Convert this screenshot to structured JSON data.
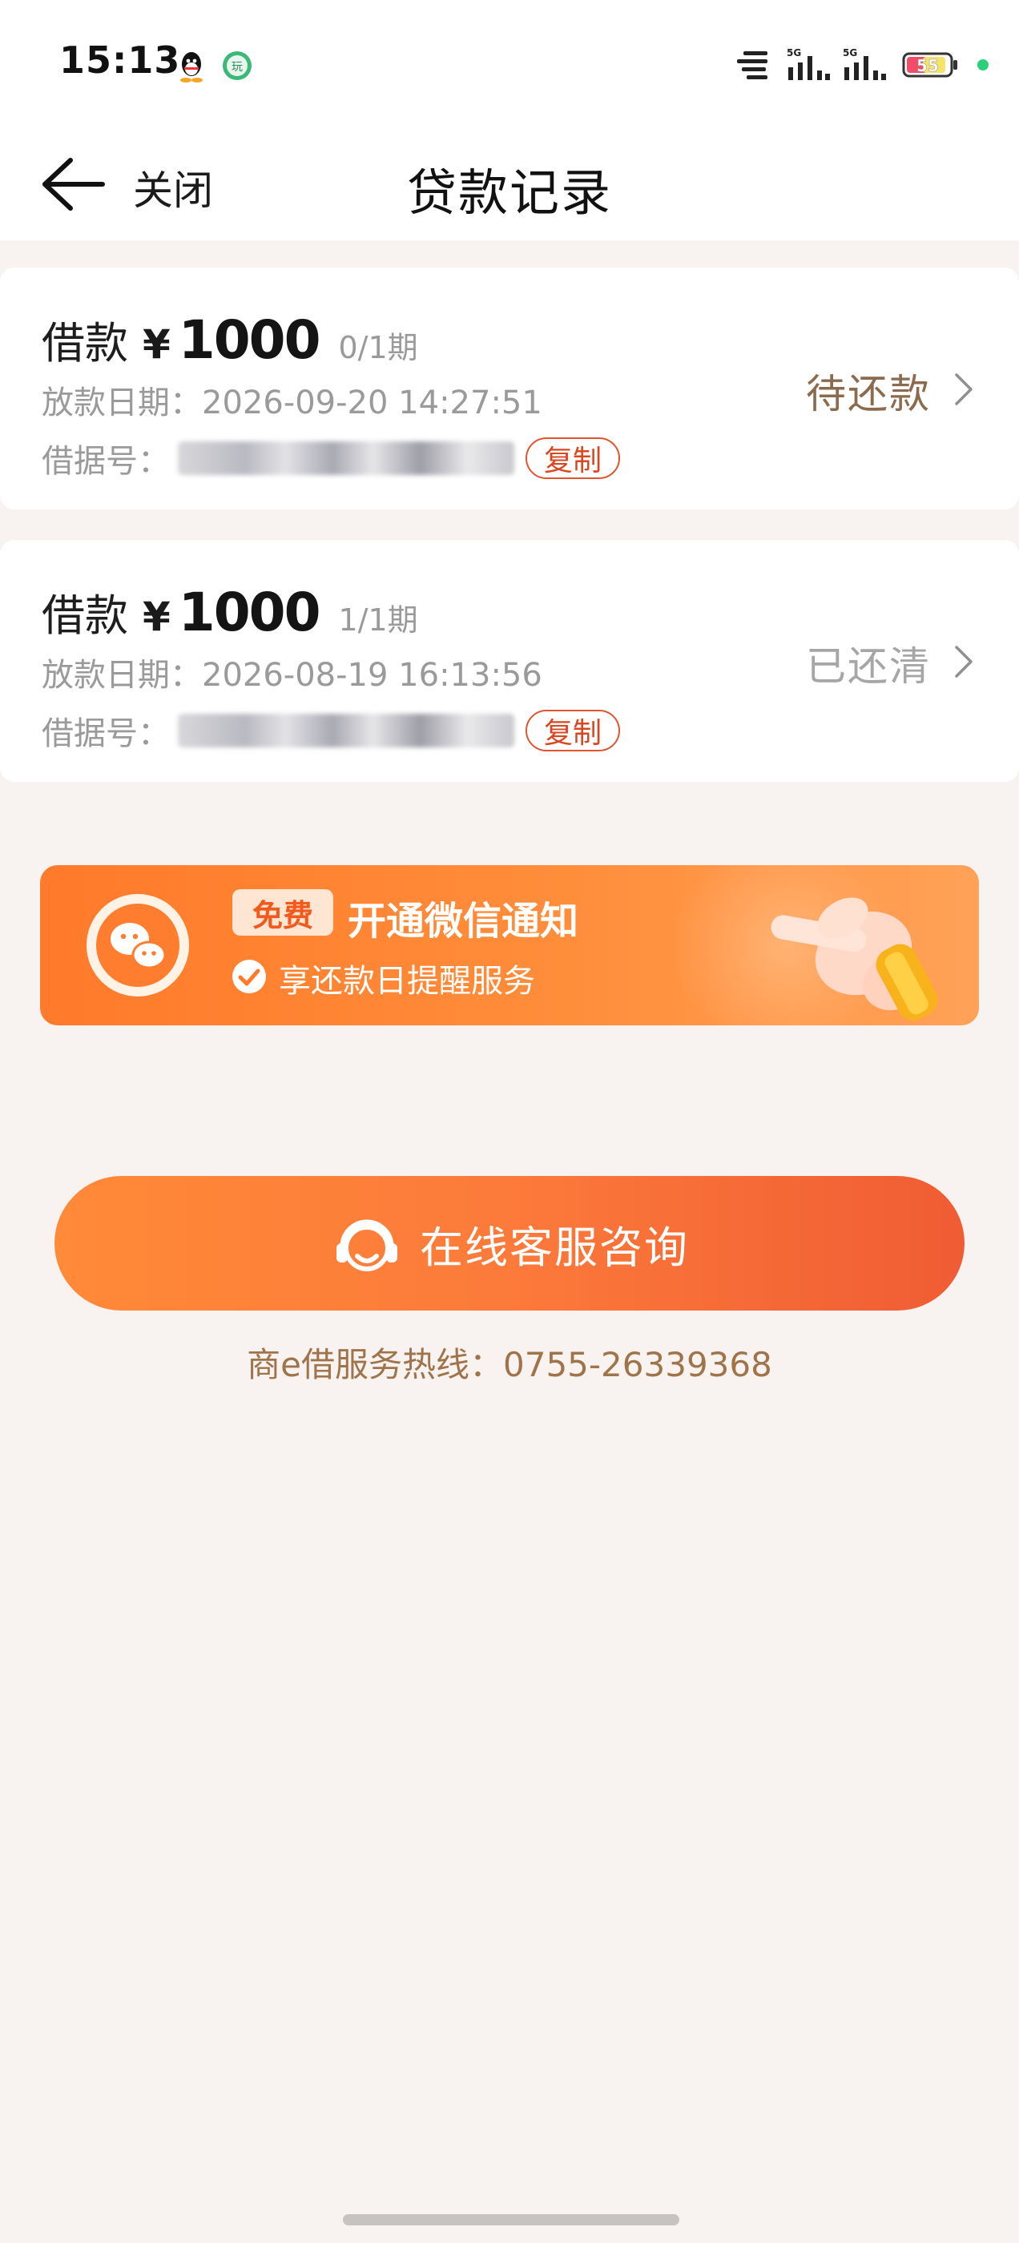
{
  "status_bar": {
    "time": "15:13",
    "battery_level": "55"
  },
  "nav": {
    "close_label": "关闭",
    "title": "贷款记录"
  },
  "loans": [
    {
      "label": "借款",
      "currency": "¥",
      "amount": "1000",
      "period": "0/1期",
      "date": "放款日期：2026-09-20 14:27:51",
      "note_label": "借据号：",
      "copy_label": "复制",
      "status": "待还款"
    },
    {
      "label": "借款",
      "currency": "¥",
      "amount": "1000",
      "period": "1/1期",
      "date": "放款日期：2026-08-19 16:13:56",
      "note_label": "借据号：",
      "copy_label": "复制",
      "status": "已还清"
    }
  ],
  "banner": {
    "badge": "免费",
    "title": "开通微信通知",
    "subtitle": "享还款日提醒服务"
  },
  "service": {
    "button_label": "在线客服咨询",
    "hotline": "商e借服务热线：0755-26339368"
  },
  "colors": {
    "accent": "#ff7a2a",
    "accent_dark": "#f05c34",
    "pending_status": "#8b6a4e",
    "done_status": "#a6a6a6",
    "copy_red": "#d8471f",
    "hotline": "#a0744a",
    "background": "#f8f3f1"
  }
}
